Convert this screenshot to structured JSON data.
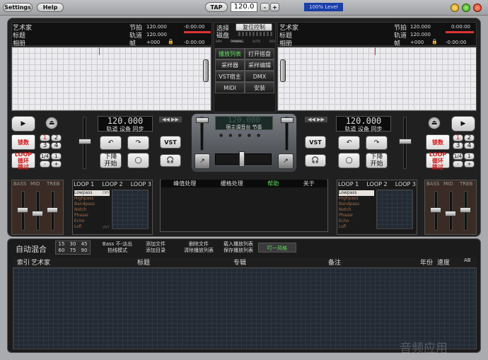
{
  "topbar": {
    "settings": "Settings",
    "help": "Help",
    "tap": "TAP",
    "bpm": "120.0",
    "minus": "-",
    "plus": "+",
    "level": "100% Level"
  },
  "deckA": {
    "artist_label": "艺术家",
    "title_label": "标题",
    "album_label": "相册",
    "beat_label": "节拍",
    "track_label": "轨道",
    "frame_label": "帧",
    "beat_val": "120.000",
    "track_val": "120.000",
    "frame_val": "+000",
    "time1": "-0:00:00",
    "time2": "-0:00:00"
  },
  "deckB": {
    "artist_label": "艺术家",
    "title_label": "标题",
    "album_label": "相册",
    "beat_label": "节拍",
    "track_label": "轨道",
    "frame_label": "帧",
    "beat_val": "120.000",
    "track_val": "120.000",
    "frame_val": "+000",
    "time1": "0:00:00",
    "time2": "-0:00:00"
  },
  "center": {
    "select": "选择",
    "disk": "磁盘",
    "restore": "复位控制",
    "labels": [
      "BPM",
      "PANNING",
      "AUTO",
      "REV"
    ],
    "menu": [
      [
        "播放列表",
        "打开搭盘"
      ],
      [
        "采样器",
        "采样编辑"
      ],
      [
        "VST宿主",
        "DMX"
      ],
      [
        "MIDI",
        "安装"
      ]
    ],
    "bpm": "120.000",
    "sub": "宿主调音台 节奏"
  },
  "left": {
    "bpm": "120.000",
    "sub": "轨道 设备 同步",
    "lock": "锁数",
    "loop": "LOOP循环\n跳过",
    "down": "下降\n开始",
    "vst": "VST"
  },
  "right": {
    "bpm": "120.000",
    "sub": "轨道 设备 同步",
    "lock": "锁数",
    "loop": "LOOP循环\n跳过",
    "down": "下降\n开始",
    "vst": "VST"
  },
  "num_btns": [
    "1",
    "2",
    "3",
    "4"
  ],
  "small_btns": [
    "1/4",
    "1",
    "-",
    "+"
  ],
  "eq": {
    "bass": "BASS",
    "mid": "MID",
    "treb": "TREB"
  },
  "loops": [
    "LOOP 1",
    "LOOP 2",
    "LOOP 3"
  ],
  "filters": [
    "Lowpass",
    "Highpass",
    "Bandpass",
    "Notch",
    "Phaser",
    "Echo",
    "Lofi"
  ],
  "filter_dry": "DRY",
  "filter_vst": "VST",
  "fx_tabs": [
    "峰值处理",
    "缓格处理",
    "帮助",
    "关于"
  ],
  "playlist": {
    "automix": "自动混合",
    "times": [
      "15",
      "30",
      "45",
      "60",
      "75",
      "90"
    ],
    "actions": [
      [
        "Bass 不-淡出",
        "拍线模式"
      ],
      [
        "添加文件",
        "添加目录"
      ],
      [
        "删除文件",
        "清除播放列表"
      ],
      [
        "载入播放列表",
        "保存播放列表"
      ]
    ],
    "active": "叮一风格",
    "columns": [
      "索引",
      "艺术家",
      "标题",
      "专辑",
      "备注",
      "年份",
      "速度",
      "AB"
    ]
  },
  "watermark": "音频应用"
}
